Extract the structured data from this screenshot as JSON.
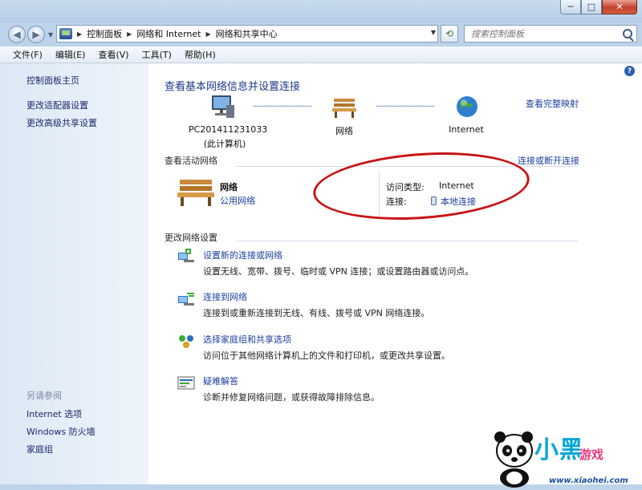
{
  "window": {
    "controls": {
      "minimize": "─",
      "maximize": "□",
      "close": "✕"
    }
  },
  "navbar": {
    "back_icon": "back-arrow-icon",
    "forward_icon": "forward-arrow-icon",
    "breadcrumbs": [
      "控制面板",
      "网络和 Internet",
      "网络和共享中心"
    ],
    "search_placeholder": "搜索控制面板"
  },
  "menu": {
    "items": [
      "文件(F)",
      "编辑(E)",
      "查看(V)",
      "工具(T)",
      "帮助(H)"
    ]
  },
  "sidebar": {
    "top_links": [
      "控制面板主页",
      "更改适配器设置",
      "更改高级共享设置"
    ],
    "see_also_heading": "另请参阅",
    "see_also_links": [
      "Internet 选项",
      "Windows 防火墙",
      "家庭组"
    ]
  },
  "main": {
    "title": "查看基本网络信息并设置连接",
    "full_map_link": "查看完整映射",
    "map": {
      "computer_name": "PC201411231033",
      "computer_sub": "(此计算机)",
      "network": "网络",
      "internet": "Internet"
    },
    "active_networks_label": "查看活动网络",
    "connect_disconnect_link": "连接或断开连接",
    "active_network": {
      "name": "网络",
      "type": "公用网络",
      "access_type_label": "访问类型:",
      "access_type_value": "Internet",
      "connection_label": "连接:",
      "connection_value": "本地连接"
    },
    "change_settings_label": "更改网络设置",
    "tasks": [
      {
        "title": "设置新的连接或网络",
        "desc": "设置无线、宽带、拨号、临时或 VPN 连接；或设置路由器或访问点。"
      },
      {
        "title": "连接到网络",
        "desc": "连接到或重新连接到无线、有线、拨号或 VPN 网络连接。"
      },
      {
        "title": "选择家庭组和共享选项",
        "desc": "访问位于其他网络计算机上的文件和打印机，或更改共享设置。"
      },
      {
        "title": "疑难解答",
        "desc": "诊断并修复网络问题，或获得故障排除信息。"
      }
    ]
  },
  "watermark": {
    "text": "小黑",
    "sub": "游戏",
    "url": "www.xiaohei.com"
  },
  "colors": {
    "link": "#1a3f9e",
    "title": "#1e3a8a",
    "annotation": "#c81414"
  }
}
